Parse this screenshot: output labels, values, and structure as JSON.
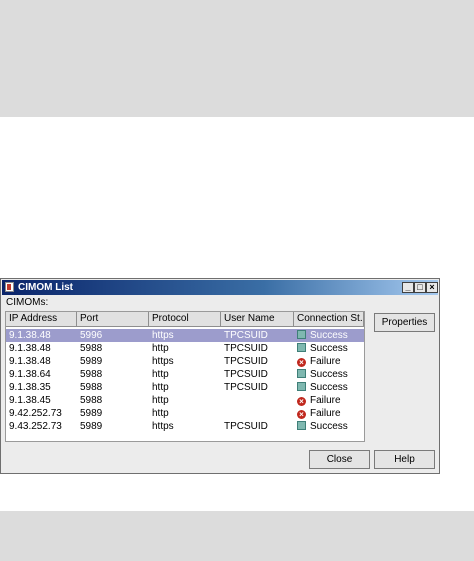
{
  "window": {
    "title": "CIMOM List",
    "min_glyph": "_",
    "max_glyph": "□",
    "close_glyph": "×"
  },
  "cimoms_label": "CIMOMs:",
  "table": {
    "columns": [
      "IP Address",
      "Port",
      "Protocol",
      "User Name",
      "Connection St..."
    ],
    "rows": [
      {
        "ip": "9.1.38.48",
        "port": "5996",
        "protocol": "https",
        "user": "TPCSUID",
        "status": "Success",
        "status_icon": "success-icon",
        "selected": true
      },
      {
        "ip": "9.1.38.48",
        "port": "5988",
        "protocol": "http",
        "user": "TPCSUID",
        "status": "Success",
        "status_icon": "success-icon",
        "selected": false
      },
      {
        "ip": "9.1.38.48",
        "port": "5989",
        "protocol": "https",
        "user": "TPCSUID",
        "status": "Failure",
        "status_icon": "failure-icon",
        "selected": false
      },
      {
        "ip": "9.1.38.64",
        "port": "5988",
        "protocol": "http",
        "user": "TPCSUID",
        "status": "Success",
        "status_icon": "success-icon",
        "selected": false
      },
      {
        "ip": "9.1.38.35",
        "port": "5988",
        "protocol": "http",
        "user": "TPCSUID",
        "status": "Success",
        "status_icon": "success-icon",
        "selected": false
      },
      {
        "ip": "9.1.38.45",
        "port": "5988",
        "protocol": "http",
        "user": "",
        "status": "Failure",
        "status_icon": "failure-icon",
        "selected": false
      },
      {
        "ip": "9.42.252.73",
        "port": "5989",
        "protocol": "http",
        "user": "",
        "status": "Failure",
        "status_icon": "failure-icon",
        "selected": false
      },
      {
        "ip": "9.43.252.73",
        "port": "5989",
        "protocol": "https",
        "user": "TPCSUID",
        "status": "Success",
        "status_icon": "success-icon",
        "selected": false
      }
    ]
  },
  "buttons": {
    "properties": "Properties",
    "close": "Close",
    "help": "Help"
  },
  "colors": {
    "selection": "#9c9ccc",
    "success": "#7fb8b0",
    "failure": "#c0281e",
    "titlebar": "#0a246a"
  }
}
